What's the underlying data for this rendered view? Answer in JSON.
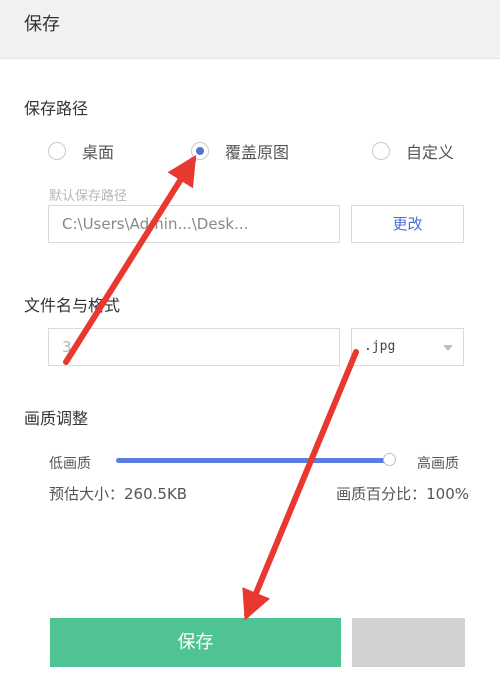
{
  "window": {
    "title": "保存"
  },
  "save_path": {
    "title": "保存路径",
    "options": [
      {
        "label": "桌面",
        "checked": false
      },
      {
        "label": "覆盖原图",
        "checked": true
      },
      {
        "label": "自定义",
        "checked": false
      }
    ],
    "default_label": "默认保存路径",
    "path_value": "C:\\Users\\Admin...\\Desk...",
    "change_label": "更改"
  },
  "file": {
    "title": "文件名与格式",
    "name_value": "3",
    "format_value": ".jpg"
  },
  "quality": {
    "title": "画质调整",
    "low_label": "低画质",
    "high_label": "高画质",
    "level_percent": 100,
    "size_text": "预估大小：260.5KB",
    "percent_text": "画质百分比：100%"
  },
  "actions": {
    "save_label": "保存",
    "cancel_label": ""
  },
  "colors": {
    "accent": "#5472d3",
    "save_green": "#4fc394",
    "arrow_red": "#e8382f"
  }
}
